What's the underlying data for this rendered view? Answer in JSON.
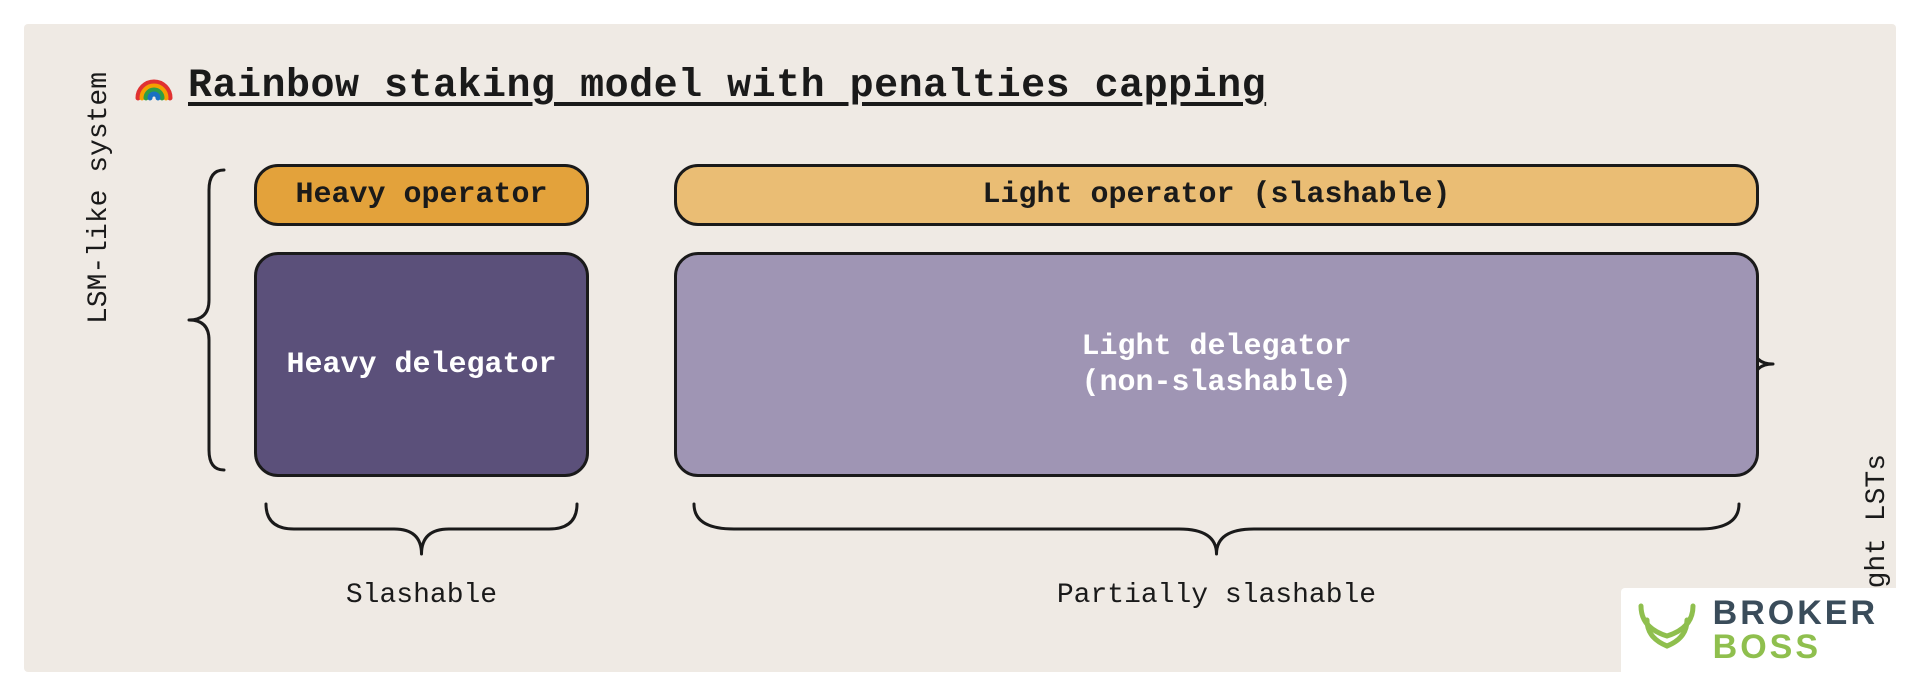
{
  "title": "Rainbow staking model with penalties capping",
  "left_axis_label": "LSM-like system",
  "right_axis_label": "Light LSTs",
  "blocks": {
    "heavy_operator": "Heavy operator",
    "light_operator": "Light operator (slashable)",
    "heavy_delegator": "Heavy delegator",
    "light_delegator_line1": "Light delegator",
    "light_delegator_line2": "(non-slashable)"
  },
  "bottom_labels": {
    "left": "Slashable",
    "right": "Partially slashable"
  },
  "watermark": {
    "line1": "BROKER",
    "line2": "BOSS"
  },
  "icons": {
    "title_icon": "rainbow-icon",
    "watermark_icon": "bull-horns-icon"
  },
  "colors": {
    "panel_bg": "#efeae4",
    "heavy_operator_bg": "#e3a23b",
    "light_operator_bg": "#eabd74",
    "heavy_delegator_bg": "#5b507a",
    "light_delegator_bg": "#9f95b4",
    "stroke": "#1a1a1a",
    "wm_top": "#3a4c5a",
    "wm_bot": "#8fbf4e"
  }
}
